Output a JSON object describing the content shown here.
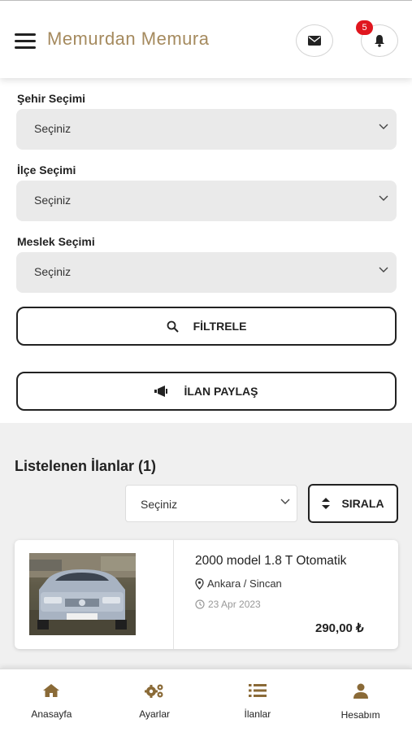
{
  "header": {
    "title": "Memurdan Memura",
    "notification_count": "5",
    "icons": [
      "menu-icon",
      "envelope-icon",
      "bell-icon"
    ]
  },
  "filters": {
    "city": {
      "label": "Şehir Seçimi",
      "value": "Seçiniz"
    },
    "district": {
      "label": "İlçe Seçimi",
      "value": "Seçiniz"
    },
    "profession": {
      "label": "Meslek Seçimi",
      "value": "Seçiniz"
    },
    "filter_button": "FİLTRELE",
    "share_button": "İLAN PAYLAŞ"
  },
  "listings": {
    "title": "Listelenen İlanlar (1)",
    "sort_select_value": "Seçiniz",
    "sort_button": "SIRALA",
    "items": [
      {
        "title": "2000 model 1.8 T Otomatik",
        "location": "Ankara / Sincan",
        "date": "23 Apr 2023",
        "price": "290,00 ₺"
      }
    ]
  },
  "bottom_nav": {
    "items": [
      {
        "label": "Anasayfa",
        "icon": "home-icon"
      },
      {
        "label": "Ayarlar",
        "icon": "gears-icon"
      },
      {
        "label": "İlanlar",
        "icon": "list-icon"
      },
      {
        "label": "Hesabım",
        "icon": "user-icon"
      }
    ]
  },
  "colors": {
    "brand": "#a58a5e",
    "badge": "#e0161e",
    "nav_icon": "#8a6a37"
  }
}
